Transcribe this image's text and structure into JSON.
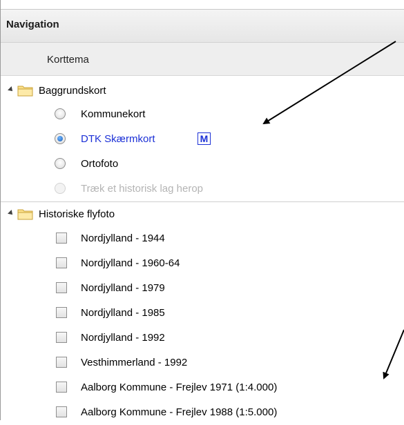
{
  "header": {
    "title": "Navigation"
  },
  "subheader": {
    "label": "Korttema"
  },
  "groups": [
    {
      "label": "Baggrundskort",
      "items": [
        {
          "label": "Kommunekort",
          "state": "unchecked"
        },
        {
          "label": "DTK Skærmkort",
          "state": "checked",
          "badge": "M"
        },
        {
          "label": "Ortofoto",
          "state": "unchecked"
        },
        {
          "label": "Træk et historisk lag herop",
          "state": "disabled"
        }
      ]
    },
    {
      "label": "Historiske flyfoto",
      "items": [
        {
          "label": "Nordjylland - 1944"
        },
        {
          "label": "Nordjylland - 1960-64"
        },
        {
          "label": "Nordjylland - 1979"
        },
        {
          "label": "Nordjylland - 1985"
        },
        {
          "label": "Nordjylland - 1992"
        },
        {
          "label": "Vesthimmerland - 1992"
        },
        {
          "label": "Aalborg Kommune - Frejlev 1971 (1:4.000)"
        },
        {
          "label": "Aalborg Kommune - Frejlev 1988 (1:5.000)"
        }
      ]
    }
  ],
  "colors": {
    "selected_text": "#1a2fd6",
    "disabled_text": "#b4b4b4",
    "header_bg": "#eeeeee"
  },
  "icons": {
    "expand": "triangle-down-icon",
    "folder": "folder-icon",
    "annotation": "arrow-icon"
  }
}
